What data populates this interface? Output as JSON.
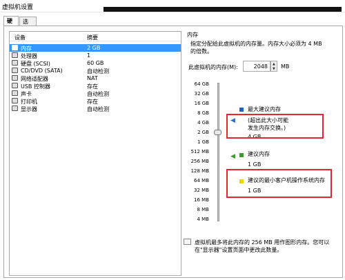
{
  "window": {
    "title": "虚拟机设置"
  },
  "tabs": [
    {
      "label": "硬件"
    },
    {
      "label": "选项"
    }
  ],
  "device_list": {
    "headers": {
      "device": "设备",
      "summary": "摘要"
    },
    "rows": [
      {
        "name": "内存",
        "value": "2 GB",
        "icon": "memory-icon"
      },
      {
        "name": "处理器",
        "value": "1",
        "icon": "processor-icon"
      },
      {
        "name": "硬盘 (SCSI)",
        "value": "60 GB",
        "icon": "hard-disk-icon"
      },
      {
        "name": "CD/DVD (SATA)",
        "value": "自动检测",
        "icon": "cd-dvd-icon"
      },
      {
        "name": "网络适配器",
        "value": "NAT",
        "icon": "network-adapter-icon"
      },
      {
        "name": "USB 控制器",
        "value": "存在",
        "icon": "usb-icon"
      },
      {
        "name": "声卡",
        "value": "自动检测",
        "icon": "sound-card-icon"
      },
      {
        "name": "打印机",
        "value": "存在",
        "icon": "printer-icon"
      },
      {
        "name": "显示器",
        "value": "自动检测",
        "icon": "display-icon"
      }
    ]
  },
  "memory": {
    "title": "内存",
    "description": "指定分配给此虚拟机的内存量。内存大小必须为 4 MB 的倍数。",
    "vm_memory_label": "此虚拟机的内存(M):",
    "vm_memory_value": "2048",
    "unit": "MB",
    "scale_ticks": [
      "64 GB",
      "32 GB",
      "16 GB",
      "8 GB",
      "4 GB",
      "2 GB",
      "1 GB",
      "512 MB",
      "256 MB",
      "128 MB",
      "64 MB",
      "32 MB",
      "16 MB",
      "8 MB",
      "4 MB"
    ],
    "max_recommended": {
      "label": "最大建议内存",
      "note_line1": "(超出此大小可能",
      "note_line2": "发生内存交换。)",
      "value": "4 GB",
      "color": "#1a63c9"
    },
    "recommended": {
      "label": "建议内存",
      "value": "1 GB",
      "color": "#3c9b2d"
    },
    "guest_min": {
      "label": "建议的最小客户机操作系统内存",
      "value": "1 GB",
      "color": "#f0d400"
    }
  },
  "footer": {
    "text": "虚拟机最多将此内存的 256 MB 用作图形内存。您可以在\"显示器\"设置页面中更改此数量。"
  }
}
